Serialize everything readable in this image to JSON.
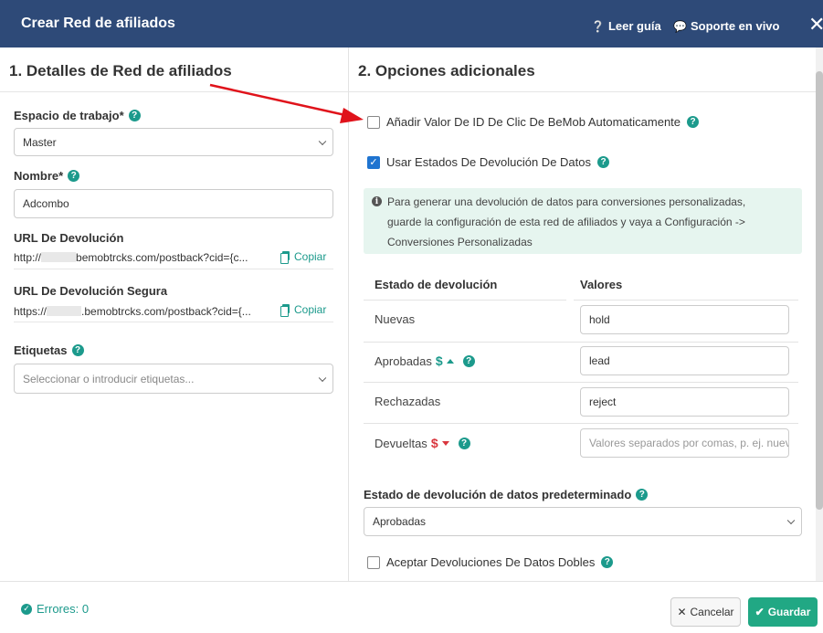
{
  "header": {
    "title": "Crear Red de afiliados",
    "guide_label": "Leer guía",
    "support_label": "Soporte en vivo",
    "close_symbol": "✕"
  },
  "left": {
    "section_title": "1. Detalles de Red de afiliados",
    "workspace": {
      "label": "Espacio de trabajo*",
      "value": "Master"
    },
    "name": {
      "label": "Nombre*",
      "value": "Adcombo"
    },
    "postback_url": {
      "label": "URL De Devolución",
      "prefix": "http://",
      "suffix": "bemobtrcks.com/postback?cid={c...",
      "copy_label": "Copiar"
    },
    "secure_postback_url": {
      "label": "URL De Devolución Segura",
      "prefix": "https://",
      "suffix": ".bemobtrcks.com/postback?cid={...",
      "copy_label": "Copiar"
    },
    "tags": {
      "label": "Etiquetas",
      "placeholder": "Seleccionar o introducir etiquetas..."
    }
  },
  "right": {
    "section_title": "2. Opciones adicionales",
    "append_click_id": {
      "label": "Añadir Valor De ID De Clic De BeMob Automaticamente",
      "checked": false
    },
    "use_postback_statuses": {
      "label": "Usar Estados De Devolución De Datos",
      "checked": true
    },
    "info_text_1": "Para generar una devolución de datos para conversiones personalizadas,",
    "info_text_2": "guarde la configuración de esta red de afiliados y vaya a Configuración ->",
    "info_text_3": "Conversiones Personalizadas",
    "table": {
      "col_status": "Estado de devolución",
      "col_values": "Valores",
      "rows": [
        {
          "status": "Nuevas",
          "value": "hold"
        },
        {
          "status": "Aprobadas",
          "value": "lead"
        },
        {
          "status": "Rechazadas",
          "value": "reject"
        },
        {
          "status": "Devueltas",
          "value": "",
          "placeholder": "Valores separados por comas, p. ej. nuevo"
        }
      ]
    },
    "default_status": {
      "label": "Estado de devolución de datos predeterminado",
      "value": "Aprobadas"
    },
    "accept_duplicates": {
      "label": "Aceptar Devoluciones De Datos Dobles",
      "checked": false
    }
  },
  "footer": {
    "errors_label": "Errores: 0",
    "cancel_label": "Cancelar",
    "save_label": "Guardar"
  },
  "colors": {
    "header_bg": "#2e4a78",
    "accent_teal": "#1c9a8c",
    "save_green": "#21a884",
    "checkbox_blue": "#1f74d0",
    "arrow_red": "#e0131b"
  }
}
